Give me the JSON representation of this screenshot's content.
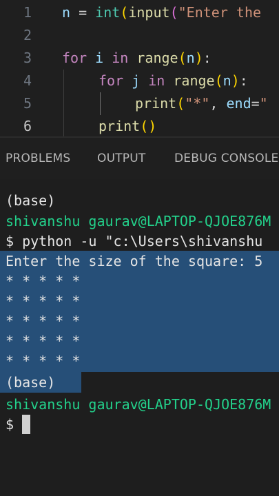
{
  "editor": {
    "lines": [
      {
        "number": "1",
        "text": "n = int(input(\"Enter the"
      },
      {
        "number": "2",
        "text": ""
      },
      {
        "number": "3",
        "text": "for i in range(n):"
      },
      {
        "number": "4",
        "text": "for j in range(n):"
      },
      {
        "number": "5",
        "text": "print(\"*\", end=\""
      },
      {
        "number": "6",
        "text": "print()"
      }
    ],
    "active_line": "6",
    "tokens": {
      "l1_var": "n",
      "l1_eq": " = ",
      "l1_int": "int",
      "l1_p1": "(",
      "l1_input": "input",
      "l1_p2": "(",
      "l1_str": "\"Enter the",
      "l3_for": "for",
      "l3_i": " i ",
      "l3_in": "in",
      "l3_range": " range",
      "l3_p1": "(",
      "l3_n": "n",
      "l3_p2": ")",
      "l3_colon": ":",
      "l4_for": "for",
      "l4_j": " j ",
      "l4_in": "in",
      "l4_range": " range",
      "l4_p1": "(",
      "l4_n": "n",
      "l4_p2": ")",
      "l4_colon": ":",
      "l5_print": "print",
      "l5_p1": "(",
      "l5_star": "\"*\"",
      "l5_comma": ", ",
      "l5_end": "end",
      "l5_eq": "=",
      "l5_str": "\"",
      "l6_print": "print",
      "l6_p1": "(",
      "l6_p2": ")"
    }
  },
  "panel": {
    "tabs": [
      "PROBLEMS",
      "OUTPUT",
      "DEBUG CONSOLE"
    ]
  },
  "terminal": {
    "lines": [
      "(base)",
      "shivanshu gaurav@LAPTOP-QJOE876M",
      "$ python -u \"c:\\Users\\shivanshu",
      "Enter the size of the square: 5",
      "* * * * *",
      "* * * * *",
      "* * * * *",
      "* * * * *",
      "* * * * *",
      "(base)",
      "shivanshu gaurav@LAPTOP-QJOE876M",
      "$"
    ]
  },
  "colors": {
    "editor_bg": "#1f1f1f",
    "terminal_bg": "#1e1e1e",
    "selection": "#264f78",
    "prompt_green": "#23d18b",
    "keyword": "#c586c0",
    "function": "#dcdcaa",
    "string": "#ce9178"
  }
}
